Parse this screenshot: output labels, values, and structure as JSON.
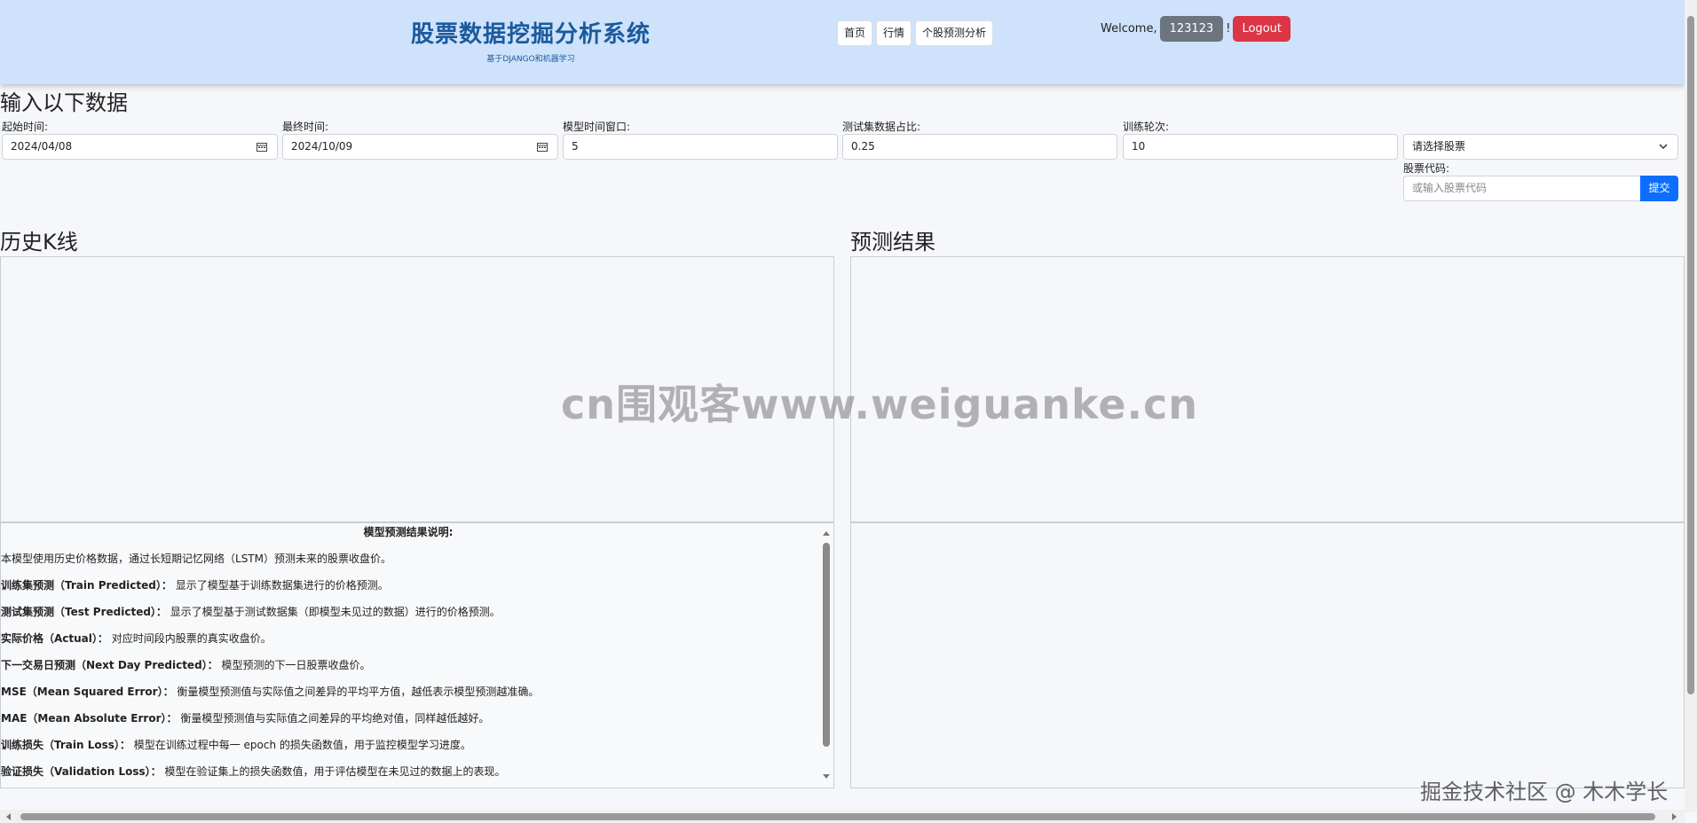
{
  "header": {
    "brand_title": "股票数据挖掘分析系统",
    "brand_subtitle": "基于DJANGO和机器学习",
    "nav": [
      {
        "label": "首页"
      },
      {
        "label": "行情"
      },
      {
        "label": "个股预测分析"
      }
    ],
    "welcome_text": "Welcome,",
    "username": "123123",
    "exclaim": "!",
    "logout_label": "Logout"
  },
  "form": {
    "heading": "输入以下数据",
    "start_date": {
      "label": "起始时间:",
      "value": "2024/04/08"
    },
    "end_date": {
      "label": "最终时间:",
      "value": "2024/10/09"
    },
    "window": {
      "label": "模型时间窗口:",
      "value": "5"
    },
    "test_ratio": {
      "label": "测试集数据占比:",
      "value": "0.25"
    },
    "epochs": {
      "label": "训练轮次:",
      "value": "10"
    },
    "stock_select": {
      "selected": "请选择股票"
    },
    "stock_code": {
      "label": "股票代码:",
      "placeholder": "或输入股票代码"
    },
    "submit_label": "提交"
  },
  "kline": {
    "heading": "历史K线"
  },
  "prediction": {
    "heading": "预测结果"
  },
  "explanation": {
    "title": "模型预测结果说明:",
    "intro": "本模型使用历史价格数据，通过长短期记忆网络（LSTM）预测未来的股票收盘价。",
    "items": [
      {
        "term": "训练集预测（Train Predicted）：",
        "desc": "显示了模型基于训练数据集进行的价格预测。"
      },
      {
        "term": "测试集预测（Test Predicted）：",
        "desc": "显示了模型基于测试数据集（即模型未见过的数据）进行的价格预测。"
      },
      {
        "term": "实际价格（Actual）：",
        "desc": "对应时间段内股票的真实收盘价。"
      },
      {
        "term": "下一交易日预测（Next Day Predicted）：",
        "desc": "模型预测的下一日股票收盘价。"
      },
      {
        "term": "MSE（Mean Squared Error）：",
        "desc": "衡量模型预测值与实际值之间差异的平均平方值，越低表示模型预测越准确。"
      },
      {
        "term": "MAE（Mean Absolute Error）：",
        "desc": "衡量模型预测值与实际值之间差异的平均绝对值，同样越低越好。"
      },
      {
        "term": "训练损失（Train Loss）：",
        "desc": "模型在训练过程中每一 epoch 的损失函数值，用于监控模型学习进度。"
      },
      {
        "term": "验证损失（Validation Loss）：",
        "desc": "模型在验证集上的损失函数值，用于评估模型在未见过的数据上的表现。"
      }
    ]
  },
  "watermarks": {
    "center": "cn围观客www.weiguanke.cn",
    "corner": "掘金技术社区 @ 木木学长"
  }
}
